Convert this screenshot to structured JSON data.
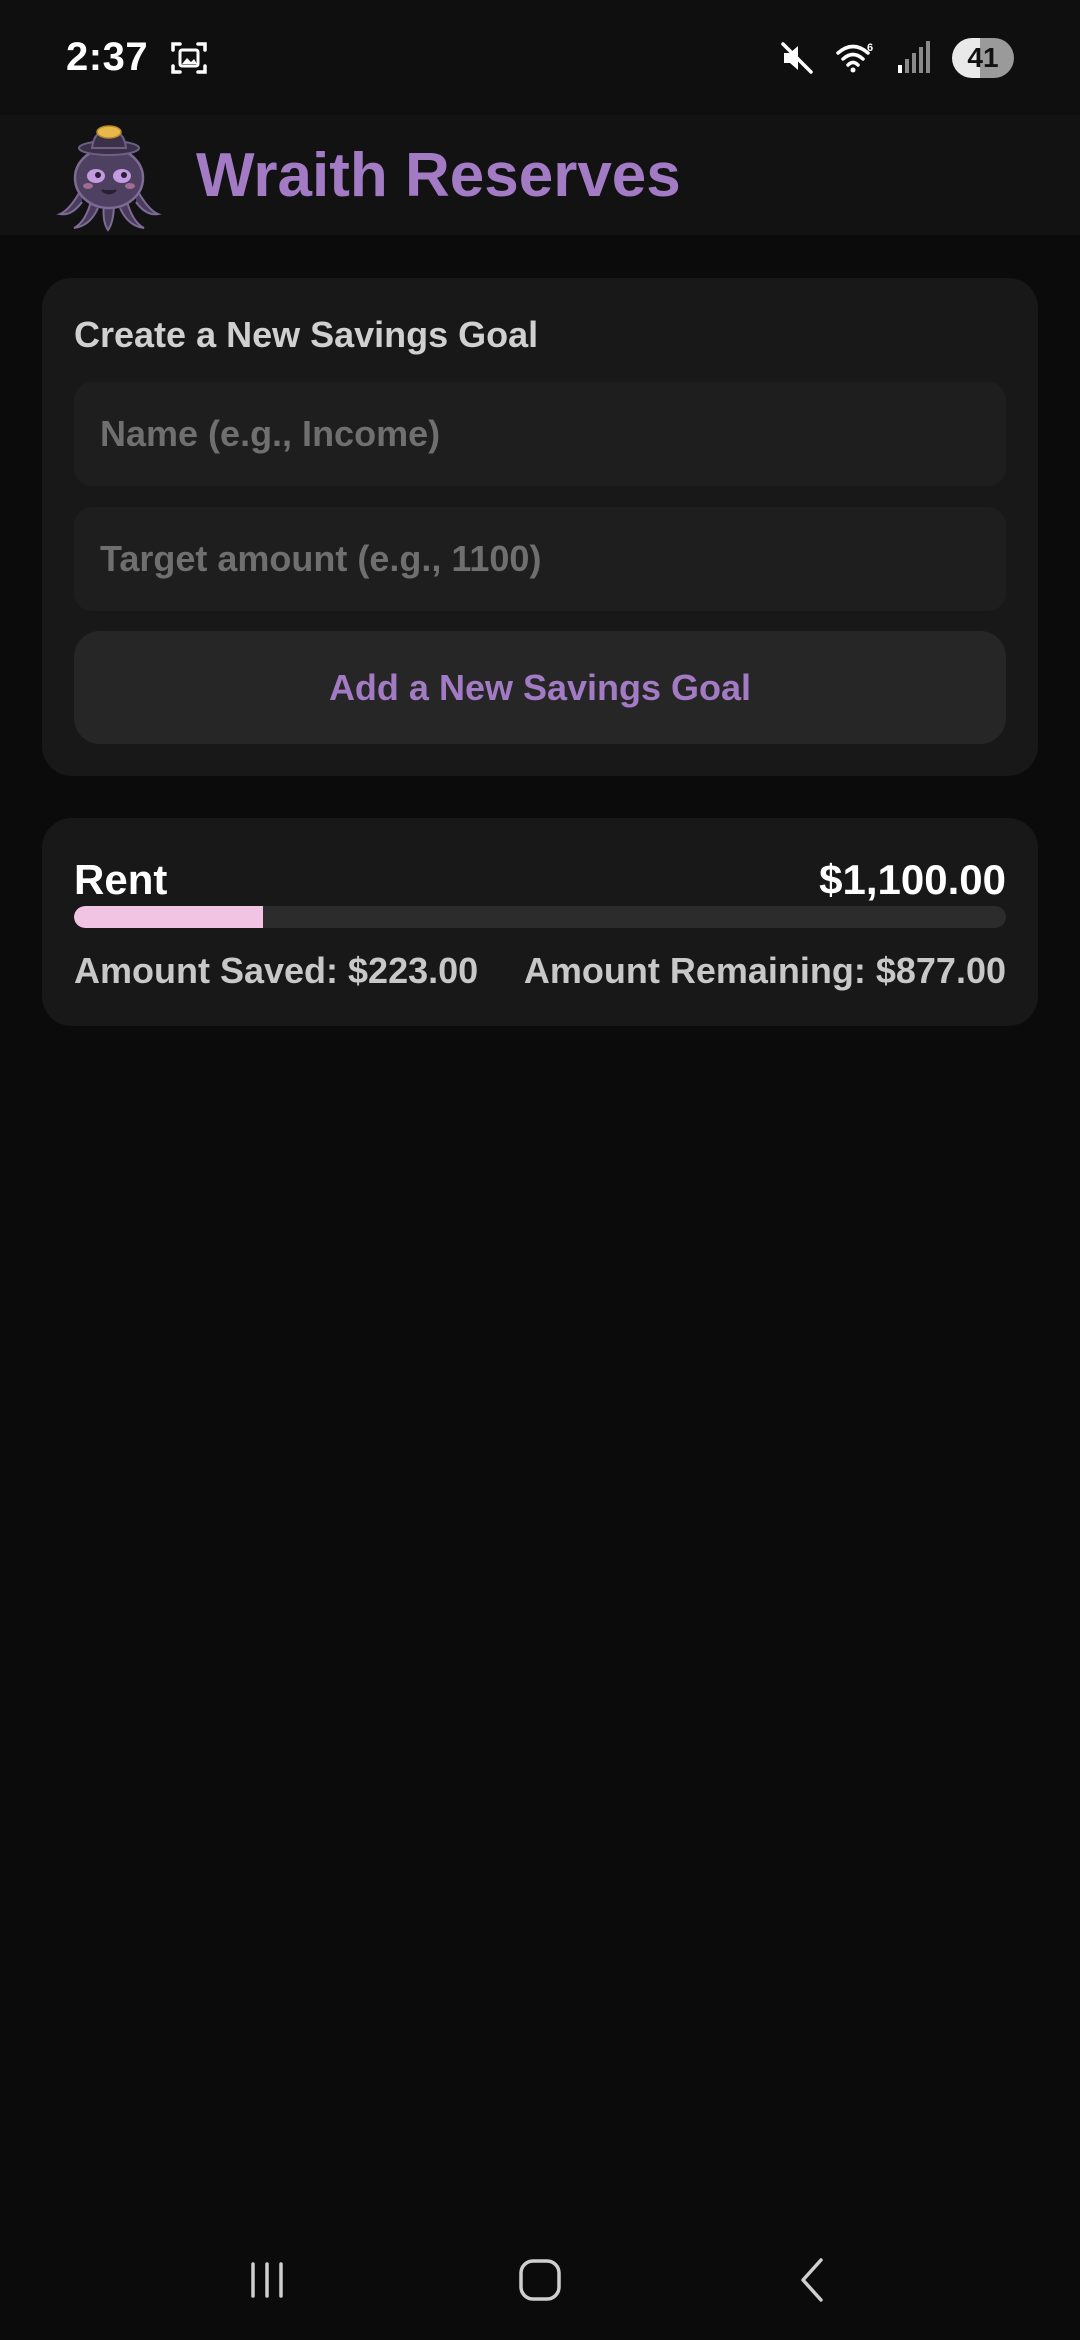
{
  "status_bar": {
    "time": "2:37",
    "battery_level": "41",
    "icons": [
      "screenshot-icon",
      "mute-icon",
      "wifi-icon",
      "signal-icon"
    ]
  },
  "header": {
    "title": "Wraith Reserves",
    "logo": "octopus-mascot-logo"
  },
  "create_goal": {
    "heading": "Create a New Savings Goal",
    "name_placeholder": "Name (e.g., Income)",
    "name_value": "",
    "amount_placeholder": "Target amount (e.g., 1100)",
    "amount_value": "",
    "add_button_label": "Add a New Savings Goal"
  },
  "goals": [
    {
      "name": "Rent",
      "target": "$1,100.00",
      "saved_label": "Amount Saved: $223.00",
      "remaining_label": "Amount Remaining: $877.00",
      "progress_fraction": 0.2027
    }
  ],
  "colors": {
    "accent": "#a37bc4",
    "progress_fill": "#f2c4e4",
    "background": "#0b0b0b",
    "card": "#181818"
  },
  "nav_bar": {
    "icons": [
      "recents-icon",
      "home-icon",
      "back-icon"
    ]
  }
}
